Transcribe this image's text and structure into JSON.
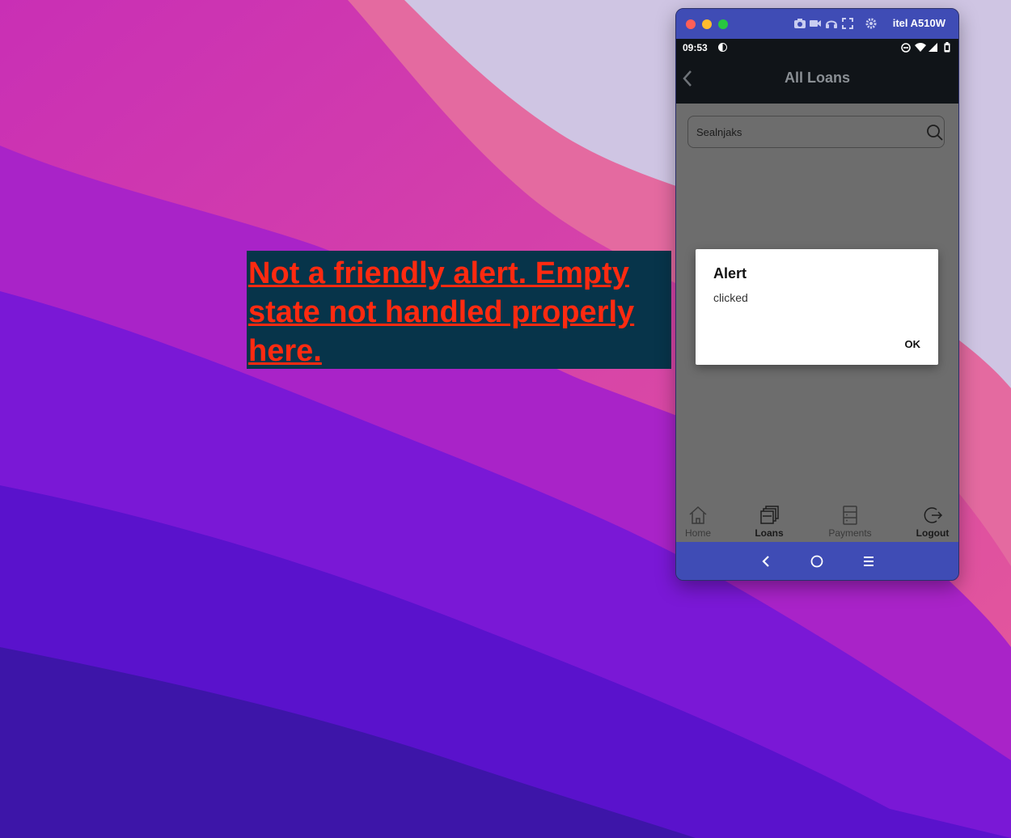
{
  "annotation": {
    "lines": [
      "Not a friendly alert. Empty",
      "state not handled properly",
      "here."
    ],
    "text_color": "#ff2a10",
    "background": "#07344a"
  },
  "window": {
    "device_name": "itel A510W",
    "titlebar_icons": [
      "camera-icon",
      "video-icon",
      "headphones-icon",
      "fullscreen-icon",
      "gear-icon"
    ]
  },
  "statusbar": {
    "time": "09:53"
  },
  "appbar": {
    "title": "All Loans"
  },
  "search": {
    "value": "Sealnjaks"
  },
  "alert": {
    "title": "Alert",
    "message": "clicked",
    "ok_label": "OK"
  },
  "bottom_nav": {
    "items": [
      {
        "label": "Home",
        "icon": "home-icon"
      },
      {
        "label": "Loans",
        "icon": "loans-icon"
      },
      {
        "label": "Payments",
        "icon": "payments-icon"
      },
      {
        "label": "Logout",
        "icon": "logout-icon"
      }
    ]
  },
  "colors": {
    "window_chrome": "#3f4cb5",
    "appbar": "#101418",
    "screen_overlay": "#6d6d6d",
    "alert_text": "#ff2a10"
  }
}
